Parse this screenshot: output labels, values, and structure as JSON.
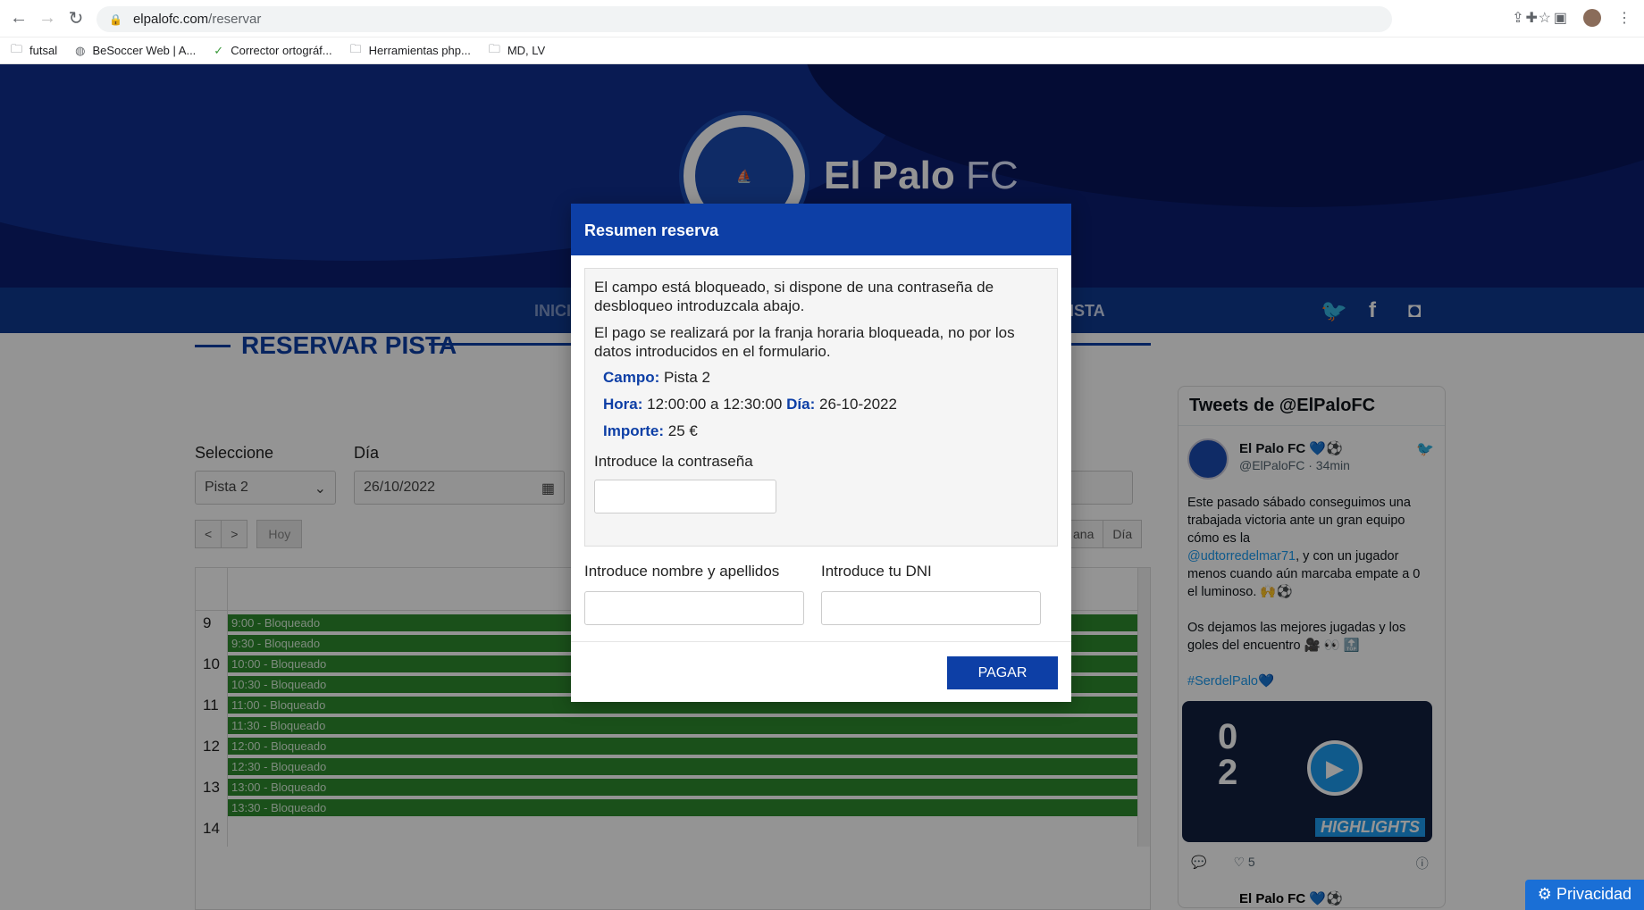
{
  "browser": {
    "url_domain": "elpalofc.com",
    "url_path": "/reservar",
    "bookmarks": [
      {
        "label": "futsal",
        "icon": "folder-icon"
      },
      {
        "label": "BeSoccer Web | A...",
        "icon": "globe-icon"
      },
      {
        "label": "Corrector ortográf...",
        "icon": "abc-icon"
      },
      {
        "label": "Herramientas php...",
        "icon": "folder-icon"
      },
      {
        "label": "MD, LV",
        "icon": "folder-icon"
      }
    ]
  },
  "site": {
    "brand_main": "El Palo",
    "brand_suffix": "FC",
    "nav_left": "INICI",
    "nav_right": "PISTA",
    "section_title": "RESERVAR PISTA"
  },
  "form": {
    "select_label": "Seleccione",
    "select_value": "Pista 2",
    "day_label": "Día",
    "day_value": "26/10/2022"
  },
  "calendar": {
    "prev": "<",
    "next": ">",
    "today": "Hoy",
    "week_partial": "ana",
    "day": "Día",
    "hours": [
      "9",
      "10",
      "11",
      "12",
      "13",
      "14"
    ],
    "slots": [
      {
        "time": "9:00",
        "status": "Bloqueado"
      },
      {
        "time": "9:30",
        "status": "Bloqueado"
      },
      {
        "time": "10:00",
        "status": "Bloqueado"
      },
      {
        "time": "10:30",
        "status": "Bloqueado"
      },
      {
        "time": "11:00",
        "status": "Bloqueado"
      },
      {
        "time": "11:30",
        "status": "Bloqueado"
      },
      {
        "time": "12:00",
        "status": "Bloqueado"
      },
      {
        "time": "12:30",
        "status": "Bloqueado"
      },
      {
        "time": "13:00",
        "status": "Bloqueado"
      },
      {
        "time": "13:30",
        "status": "Bloqueado"
      }
    ]
  },
  "twitter": {
    "title": "Tweets de @ElPaloFC",
    "name": "El Palo FC 💙⚽",
    "handle": "@ElPaloFC · 34min",
    "text_1": "Este pasado sábado conseguimos una trabajada victoria ante un gran equipo  cómo es la",
    "mention": "@udtorredelmar71",
    "text_2": ", y con un jugador menos cuando aún marcaba empate a 0 el luminoso. 🙌⚽",
    "text_3": "Os dejamos las mejores jugadas y los goles del encuentro 🎥 👀 🔝",
    "hashtag": "#SerdelPalo💙",
    "media_score_top": "0",
    "media_score_bottom": "2",
    "media_label": "HIGHLIGHTS",
    "likes": "5",
    "next_name": "El Palo FC 💙⚽"
  },
  "modal": {
    "title": "Resumen reserva",
    "info_1": "El campo está bloqueado, si dispone de una contraseña de desbloqueo introduzcala abajo.",
    "info_2": "El pago se realizará por la franja horaria bloqueada, no por los datos introducidos en el formulario.",
    "campo_label": "Campo:",
    "campo_value": "Pista 2",
    "hora_label": "Hora:",
    "hora_value": "12:00:00 a 12:30:00",
    "dia_label": "Día:",
    "dia_value": "26-10-2022",
    "importe_label": "Importe:",
    "importe_value": "25 €",
    "password_label": "Introduce la contraseña",
    "name_label": "Introduce nombre y apellidos",
    "dni_label": "Introduce tu DNI",
    "pay_button": "PAGAR"
  },
  "privacy": "Privacidad"
}
